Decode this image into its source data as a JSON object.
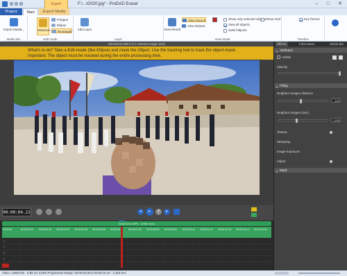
{
  "window": {
    "title": "F:\\...\\G020.jpg* - ProDAD Eraser",
    "context_tab": "Export",
    "controls": [
      "–",
      "□",
      "✕"
    ]
  },
  "tabs": {
    "project": "Project",
    "start": "Start",
    "export": "Export Media"
  },
  "ribbon": {
    "import_label": "Import Media...",
    "media_bin_group": "Media Bin",
    "select_label": "Selection",
    "polygon_label": "Polygon",
    "ellipse_label": "Ellipse",
    "rectangle_label": "Rectangle",
    "edit_mode_group": "Edit mode",
    "add_layer_label": "Add Layer",
    "layer_group": "Layer",
    "view_result_label": "View Result",
    "view_source_label": "View Source",
    "view_mixture_label": "View Mixture",
    "show_selected_label": "Show only selected objects",
    "view_all_label": "View all objects",
    "solid_objects_label": "Solid Objects",
    "show_grid_label": "Show Grid",
    "view_mode_group": "View Mode",
    "key_frames_label": "Key frames",
    "timeline_group": "Timeline"
  },
  "media_header": "IMAG0210.MP4    (1:1  Normal Image Size)",
  "hint": {
    "line1": "What's to do?  Take a Edit-mode (like Ellipse) and mask the Object. Use the tracking tool to track the object-mask.",
    "line2": "Important: The object must be masked during the entire processing time."
  },
  "transport": {
    "timecode": "00:00:04.22",
    "buttons": [
      "prev-frame",
      "play",
      "pause",
      "next-frame"
    ]
  },
  "timeline": {
    "clip_label": "IMAG0210.MP4  -  Writer Area",
    "ticks": [
      "00:00:00",
      "00:00:00.13",
      "00:00:02.03",
      "00:00:03.04",
      "00:00:04.05",
      "00:00:05.06",
      "00:00:06.07",
      "00:00:07.08",
      "00:00:08.09",
      "00:00:09.10",
      "00:00:10.11",
      "00:00:11.12",
      "00:00:12.13",
      "00:00:13.14",
      "00:00:14.15"
    ],
    "row_numbers": [
      "1",
      "2",
      "3",
      "4",
      "5"
    ]
  },
  "statusbar": {
    "text": "Video: 1280x720 · 8 Bit    1m 4,6Kb   Progressive   Range: 00:00:00,00 to 00:00:16,16 · 2,303 Sec"
  },
  "rightpanel": {
    "tabs": [
      "Effects",
      "Information",
      "Media Bin"
    ],
    "attributes_head": "Attributes",
    "visible_label": "Visible",
    "opacity_label": "Opacity",
    "filling_head": "Filling",
    "neighbor_distance_label": "Neighbor images distance",
    "neighbor_distance_value": "120",
    "neighbor_images_label": "Neighbor images (Sec)",
    "neighbor_images_value": "2,00",
    "texture_label": "Texture",
    "stamping_label": "Stamping",
    "image_exposure_label": "Image Exposure",
    "adjust_label": "Adjust",
    "mask_head": "Mask"
  },
  "colors": {
    "project_tab": "#2b5fb4",
    "hint_bar": "#e2b018",
    "timeline_track": "#38a35f",
    "playhead": "#c0221f"
  }
}
